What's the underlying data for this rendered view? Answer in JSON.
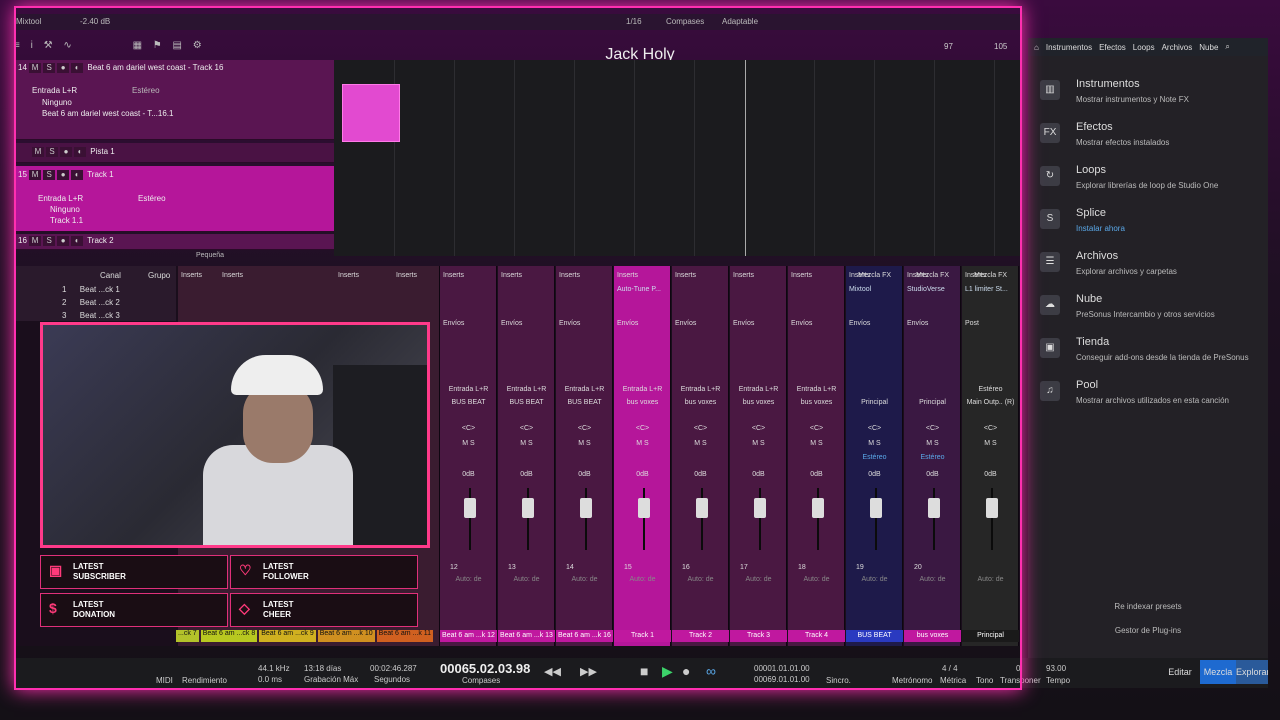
{
  "topbar": {
    "preset": "Mixtool",
    "gain": "-2.40 dB",
    "quant": "1/16",
    "timebase": "Compases",
    "snap": "Adaptable"
  },
  "song": {
    "title": "Jack Holy"
  },
  "ruler": {
    "marks": [
      "97",
      "105"
    ]
  },
  "tracks": [
    {
      "num": "14",
      "name": "Beat 6 am dariel west coast - Track 16",
      "input": "Entrada L+R",
      "mode": "Estéreo",
      "output": "Ninguno",
      "channel": "Beat 6 am dariel west coast - T...16.1"
    },
    {
      "name": "Pista 1"
    },
    {
      "num": "15",
      "name": "Track 1",
      "input": "Entrada L+R",
      "mode": "Estéreo",
      "output": "Ninguno",
      "channel": "Track 1.1"
    },
    {
      "num": "16",
      "name": "Track 2"
    }
  ],
  "size_label": "Pequeña",
  "browser": {
    "tabs": [
      "Instrumentos",
      "Efectos",
      "Loops",
      "Archivos",
      "Nube"
    ],
    "items": [
      {
        "title": "Instrumentos",
        "sub": "Mostrar instrumentos y Note FX",
        "icon": "piano"
      },
      {
        "title": "Efectos",
        "sub": "Mostrar efectos instalados",
        "icon": "FX"
      },
      {
        "title": "Loops",
        "sub": "Explorar librerías de loop de Studio One",
        "icon": "loop"
      },
      {
        "title": "Splice",
        "sub": "Instalar ahora",
        "icon": "splice"
      },
      {
        "title": "Archivos",
        "sub": "Explorar archivos y carpetas",
        "icon": "files"
      },
      {
        "title": "Nube",
        "sub": "PreSonus Intercambio y otros servicios",
        "icon": "cloud"
      },
      {
        "title": "Tienda",
        "sub": "Conseguir add-ons desde la tienda de PreSonus",
        "icon": "store"
      },
      {
        "title": "Pool",
        "sub": "Mostrar archivos utilizados en esta canción",
        "icon": "pool"
      }
    ],
    "reindex": "Re indexar presets",
    "plugins": "Gestor de Plug-ins"
  },
  "chanlist": {
    "headers": [
      "Canal",
      "Grupo"
    ],
    "rows": [
      {
        "n": "1",
        "name": "Beat ...ck 1"
      },
      {
        "n": "2",
        "name": "Beat ...ck 2"
      },
      {
        "n": "3",
        "name": "Beat ...ck 3"
      }
    ]
  },
  "mixer": {
    "channels": [
      {
        "num": "12",
        "input": "Entrada L+R",
        "out": "BUS BEAT",
        "name": "Beat 6 am ...k 12",
        "vol": "0dB",
        "insert": ""
      },
      {
        "num": "13",
        "input": "Entrada L+R",
        "out": "BUS BEAT",
        "name": "Beat 6 am ...k 13",
        "vol": "0dB",
        "insert": ""
      },
      {
        "num": "14",
        "input": "Entrada L+R",
        "out": "BUS BEAT",
        "name": "Beat 6 am ...k 16",
        "vol": "0dB",
        "insert": ""
      },
      {
        "num": "15",
        "input": "Entrada L+R",
        "out": "bus voxes",
        "name": "Track 1",
        "vol": "0dB",
        "insert": "Auto-Tune P..."
      },
      {
        "num": "16",
        "input": "Entrada L+R",
        "out": "bus voxes",
        "name": "Track 2",
        "vol": "0dB",
        "insert": ""
      },
      {
        "num": "17",
        "input": "Entrada L+R",
        "out": "bus voxes",
        "name": "Track 3",
        "vol": "0dB",
        "insert": ""
      },
      {
        "num": "18",
        "input": "Entrada L+R",
        "out": "bus voxes",
        "name": "Track 4",
        "vol": "0dB",
        "insert": ""
      },
      {
        "num": "19",
        "input": "",
        "out": "Principal",
        "name": "BUS BEAT",
        "vol": "0dB",
        "insert": "Mixtool"
      },
      {
        "num": "20",
        "input": "",
        "out": "Principal",
        "name": "bus voxes",
        "vol": "0dB",
        "insert": "StudioVerse"
      },
      {
        "num": "",
        "input": "Estéreo",
        "out": "Main Outp.. (R)",
        "name": "Principal",
        "vol": "0dB",
        "insert": "L1 limiter St..."
      }
    ],
    "left_names": [
      "...ck 7",
      "Beat 6 am ...ck 8",
      "Beat 6 am ...ck 9",
      "Beat 6 am ...k 10",
      "Beat 6 am ...k 11"
    ],
    "labels": {
      "inserts": "Inserts",
      "sends": "Envíos",
      "post": "Post",
      "pan": "<C>",
      "auto": "Auto: de",
      "mixfx": "Mezcla FX",
      "stereo": "Estéreo"
    }
  },
  "alerts": [
    {
      "label": "LATEST SUBSCRIBER"
    },
    {
      "label": "LATEST FOLLOWER"
    },
    {
      "label": "LATEST DONATION"
    },
    {
      "label": "LATEST CHEER"
    }
  ],
  "transport": {
    "midi": "MIDI",
    "perf": "Rendimiento",
    "rate": "44.1 kHz",
    "latency": "0.0 ms",
    "days": "13:18 días",
    "rec": "Grabación Máx",
    "seconds": "00:02:46.287",
    "seconds_label": "Segundos",
    "position": "00065.02.03.98",
    "position_label": "Compases",
    "loop_l": "00001.01.01.00",
    "loop_r": "00069.01.01.00",
    "sync": "Sincro.",
    "metronome": "Metrónomo",
    "timesig": "4 / 4",
    "timesig_label": "Métrica",
    "tone": "Tono",
    "transpose": "0",
    "transpose_label": "Transponer",
    "tempo": "93.00",
    "tempo_label": "Tempo"
  },
  "views": [
    "Editar",
    "Mezcla",
    "Explorar"
  ]
}
